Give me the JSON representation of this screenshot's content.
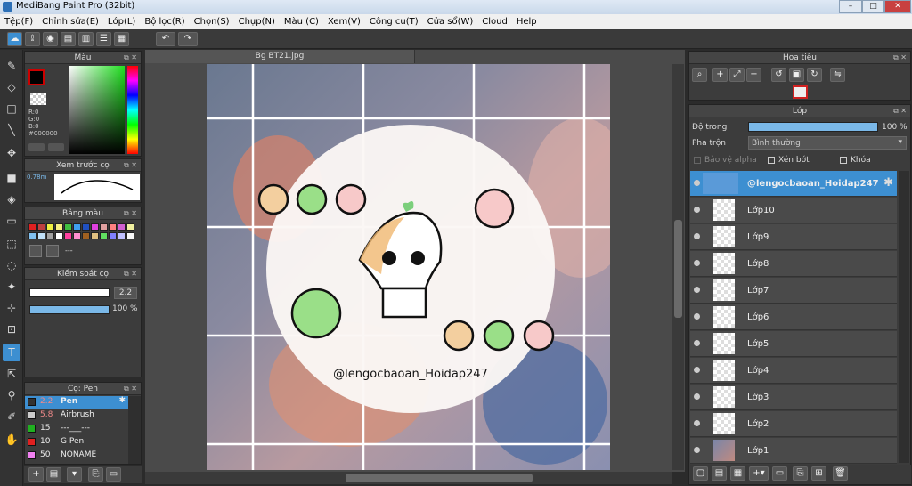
{
  "window": {
    "title": "MediBang Paint Pro (32bit)",
    "minimize": "–",
    "maximize": "□",
    "close": "✕"
  },
  "menu": [
    "Tệp(F)",
    "Chỉnh sửa(E)",
    "Lớp(L)",
    "Bộ lọc(R)",
    "Chọn(S)",
    "Chụp(N)",
    "Màu (C)",
    "Xem(V)",
    "Công cụ(T)",
    "Cửa sổ(W)",
    "Cloud",
    "Help"
  ],
  "color_panel": {
    "title": "Màu",
    "r": "R:0",
    "g": "G:0",
    "b": "B:0",
    "hex": "#000000"
  },
  "brush_preview": {
    "title": "Xem trước cọ",
    "size": "0.78m"
  },
  "palette": {
    "title": "Bảng màu",
    "name": "---",
    "colors": [
      "#e02020",
      "#c04040",
      "#f0f040",
      "#f8f080",
      "#40c040",
      "#40a0f0",
      "#2050c0",
      "#e040e0",
      "#e0a0a0",
      "#ff8080",
      "#d060d0",
      "#f0f0a0",
      "#80c0f0",
      "#c0e0f8",
      "#a0a0a0",
      "#ffffff",
      "#ff40a0",
      "#ff90d0",
      "#a06020",
      "#e0c080",
      "#60e060",
      "#8080ff",
      "#c0c0ff",
      "#f8f8f8"
    ]
  },
  "brush_control": {
    "title": "Kiểm soát cọ",
    "size": "2.2",
    "opacity": "100 %"
  },
  "brush_list": {
    "title": "Cọ: Pen",
    "items": [
      {
        "size": "2.2",
        "name": "Pen",
        "color": "#333333",
        "selected": true
      },
      {
        "size": "5.8",
        "name": "Airbrush",
        "color": "#cccccc"
      },
      {
        "size": "15",
        "name": "---___---",
        "color": "#20b020"
      },
      {
        "size": "10",
        "name": "G Pen",
        "color": "#e02020"
      },
      {
        "size": "50",
        "name": "NONAME",
        "color": "#f080f0"
      }
    ]
  },
  "document": {
    "tab": "Bg BT21.jpg",
    "watermark": "@lengocbaoan_Hoidap247"
  },
  "navigator": {
    "title": "Hoa tiêu"
  },
  "layers": {
    "title": "Lớp",
    "opacity_label": "Độ trong",
    "opacity_value": "100 %",
    "opacity": 1.0,
    "blend_label": "Pha trộn",
    "blend_value": "Bình thường",
    "protect_alpha": "Bảo vệ alpha",
    "clipping": "Xén bớt",
    "lock": "Khóa",
    "items": [
      "@lengocbaoan_Hoidap247",
      "Lớp10",
      "Lớp9",
      "Lớp8",
      "Lớp7",
      "Lớp6",
      "Lớp5",
      "Lớp4",
      "Lớp3",
      "Lớp2",
      "Lớp1"
    ]
  }
}
